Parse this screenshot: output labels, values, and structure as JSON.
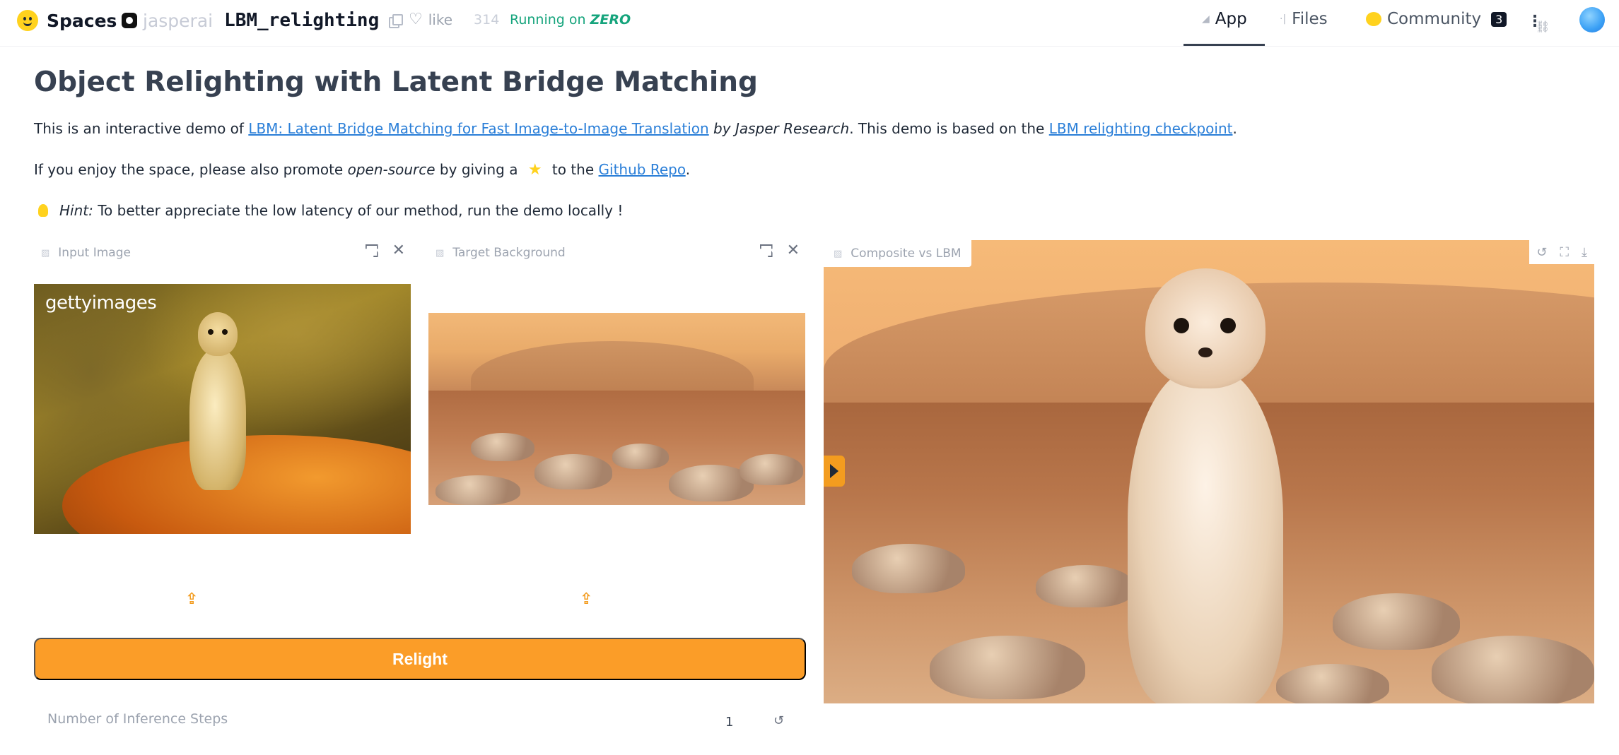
{
  "header": {
    "brand": "Spaces",
    "org": "jasperai",
    "repo": "LBM_relighting",
    "like_label": "like",
    "like_count": "314",
    "running_prefix": "Running on",
    "running_hw": "ZERO",
    "tabs": [
      {
        "label": "App",
        "icon": "app-icon"
      },
      {
        "label": "Files",
        "icon": "files-icon"
      },
      {
        "label": "Community",
        "icon": "community-icon",
        "badge": "3"
      }
    ]
  },
  "main": {
    "title": "Object Relighting with Latent Bridge Matching",
    "p1": {
      "t1": "This is an interactive demo of ",
      "link1": "LBM: Latent Bridge Matching for Fast Image-to-Image Translation",
      "t2": " by Jasper Research",
      "t3": ". This demo is based on the ",
      "link2": "LBM relighting checkpoint",
      "t4": "."
    },
    "p2": {
      "t1": "If you enjoy the space, please also promote ",
      "em": "open-source",
      "t2": " by giving a ",
      "t3": " to the ",
      "link": "Github Repo",
      "t4": "."
    },
    "p3": {
      "hint": "Hint:",
      "text": " To better appreciate the low latency of our method, run the demo locally !"
    }
  },
  "inputs": {
    "input_image_label": "Input Image",
    "target_bg_label": "Target Background",
    "composite_label": "Composite vs LBM",
    "watermark_a": "getty",
    "watermark_b": "images"
  },
  "controls": {
    "relight_label": "Relight",
    "steps_label": "Number of Inference Steps",
    "steps_value": "1"
  },
  "colors": {
    "accent": "#fb9d28",
    "link": "#2b7fd8",
    "running": "#15a47c"
  }
}
